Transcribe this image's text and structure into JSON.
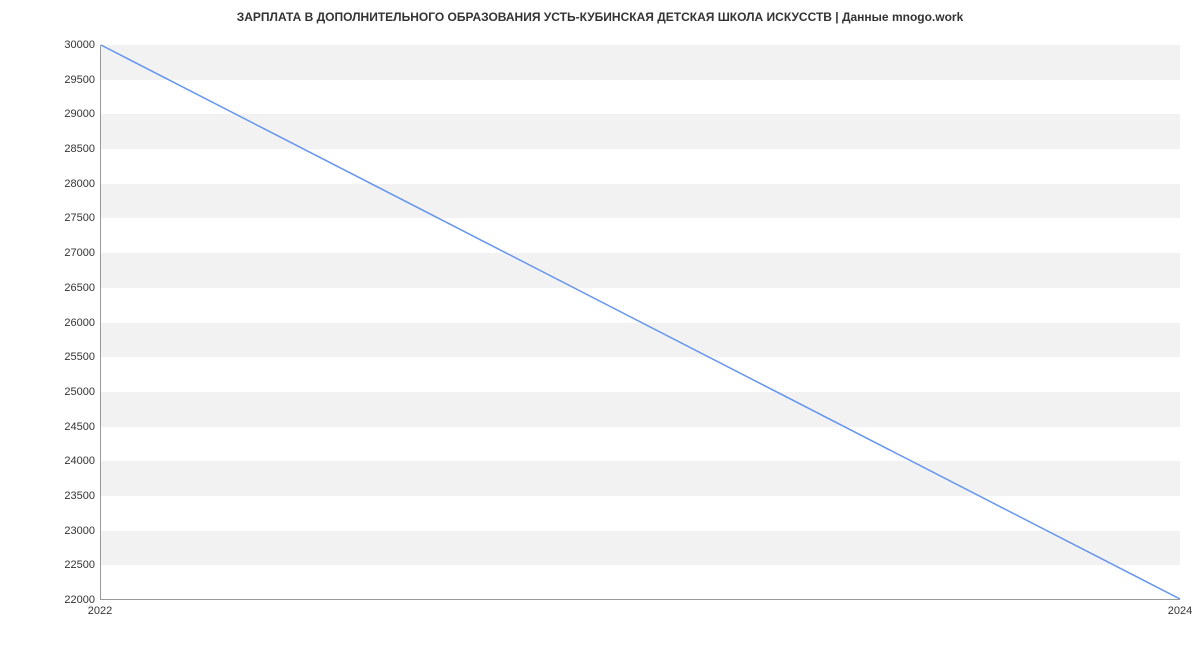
{
  "chart_data": {
    "type": "line",
    "title": "ЗАРПЛАТА В ДОПОЛНИТЕЛЬНОГО ОБРАЗОВАНИЯ УСТЬ-КУБИНСКАЯ ДЕТСКАЯ ШКОЛА ИСКУССТВ | Данные mnogo.work",
    "x": [
      2022,
      2024
    ],
    "values": [
      30000,
      22000
    ],
    "ylim": [
      22000,
      30000
    ],
    "xlim": [
      2022,
      2024
    ],
    "y_ticks": [
      22000,
      22500,
      23000,
      23500,
      24000,
      24500,
      25000,
      25500,
      26000,
      26500,
      27000,
      27500,
      28000,
      28500,
      29000,
      29500,
      30000
    ],
    "x_ticks": [
      2022,
      2024
    ],
    "xlabel": "",
    "ylabel": "",
    "line_color": "#6495ed"
  }
}
